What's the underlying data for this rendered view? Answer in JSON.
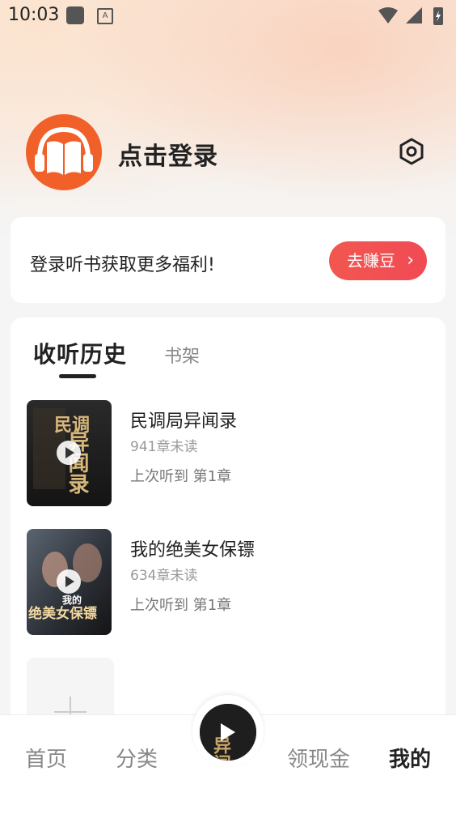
{
  "status_bar": {
    "time": "10:03"
  },
  "header": {
    "login_text": "点击登录",
    "avatar_icon": "audiobook-logo-icon",
    "settings_icon": "settings-hex-icon"
  },
  "promo": {
    "text": "登录听书获取更多福利!",
    "button_label": "去赚豆",
    "button_chevron": "›",
    "accent": "#f2524f"
  },
  "history": {
    "tabs": [
      {
        "label": "收听历史",
        "active": true
      },
      {
        "label": "书架",
        "active": false
      }
    ],
    "books": [
      {
        "title": "民调局异闻录",
        "unread": "941章未读",
        "last_played": "上次听到 第1章",
        "cover_text_a": "民调",
        "cover_text_b": "异闻录"
      },
      {
        "title": "我的绝美女保镖",
        "unread": "634章未读",
        "last_played": "上次听到 第1章",
        "cover_text_a": "我的",
        "cover_text_b": "绝美女保镖"
      }
    ],
    "add_icon": "plus-icon"
  },
  "bottom_nav": {
    "items": [
      {
        "label": "首页",
        "active": false
      },
      {
        "label": "分类",
        "active": false
      },
      {
        "label": "领现金",
        "active": false
      },
      {
        "label": "我的",
        "active": true
      }
    ],
    "player_icon": "play-icon"
  }
}
